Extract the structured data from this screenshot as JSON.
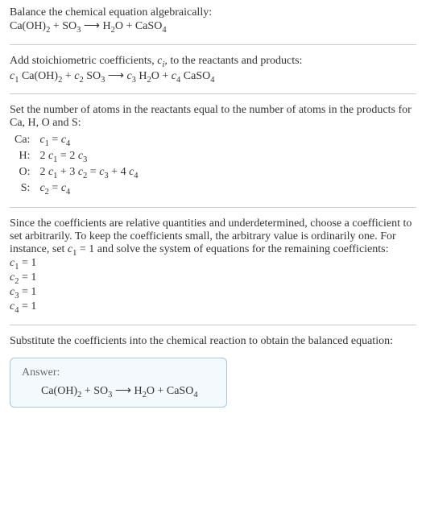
{
  "header": {
    "line1": "Balance the chemical equation algebraically:",
    "equation_html": "Ca(OH)<span class='sub'>2</span> + SO<span class='sub'>3</span> ⟶ H<span class='sub'>2</span>O + CaSO<span class='sub'>4</span>"
  },
  "step_coeff": {
    "text": "Add stoichiometric coefficients, ",
    "ci_html": "<span class='ital'>c</span><span class='sub ital'>i</span>",
    "text2": ", to the reactants and products:",
    "equation_html": "<span class='ital'>c</span><span class='sub'>1</span> Ca(OH)<span class='sub'>2</span> + <span class='ital'>c</span><span class='sub'>2</span> SO<span class='sub'>3</span> ⟶ <span class='ital'>c</span><span class='sub'>3</span> H<span class='sub'>2</span>O + <span class='ital'>c</span><span class='sub'>4</span> CaSO<span class='sub'>4</span>"
  },
  "step_atoms": {
    "text1": "Set the number of atoms in the reactants equal to the number of atoms in the products for Ca, H, O and S:",
    "rows": [
      {
        "el": "Ca:",
        "eq_html": "<span class='ital'>c</span><span class='sub'>1</span> = <span class='ital'>c</span><span class='sub'>4</span>"
      },
      {
        "el": "H:",
        "eq_html": "2 <span class='ital'>c</span><span class='sub'>1</span> = 2 <span class='ital'>c</span><span class='sub'>3</span>"
      },
      {
        "el": "O:",
        "eq_html": "2 <span class='ital'>c</span><span class='sub'>1</span> + 3 <span class='ital'>c</span><span class='sub'>2</span> = <span class='ital'>c</span><span class='sub'>3</span> + 4 <span class='ital'>c</span><span class='sub'>4</span>"
      },
      {
        "el": "S:",
        "eq_html": "<span class='ital'>c</span><span class='sub'>2</span> = <span class='ital'>c</span><span class='sub'>4</span>"
      }
    ]
  },
  "step_solve": {
    "text_html": "Since the coefficients are relative quantities and underdetermined, choose a coefficient to set arbitrarily. To keep the coefficients small, the arbitrary value is ordinarily one. For instance, set <span class='ital'>c</span><span class='sub'>1</span> = 1 and solve the system of equations for the remaining coefficients:",
    "lines_html": [
      "<span class='ital'>c</span><span class='sub'>1</span> = 1",
      "<span class='ital'>c</span><span class='sub'>2</span> = 1",
      "<span class='ital'>c</span><span class='sub'>3</span> = 1",
      "<span class='ital'>c</span><span class='sub'>4</span> = 1"
    ]
  },
  "step_sub": {
    "text": "Substitute the coefficients into the chemical reaction to obtain the balanced equation:"
  },
  "answer": {
    "label": "Answer:",
    "equation_html": "Ca(OH)<span class='sub'>2</span> + SO<span class='sub'>3</span> ⟶ H<span class='sub'>2</span>O + CaSO<span class='sub'>4</span>"
  }
}
